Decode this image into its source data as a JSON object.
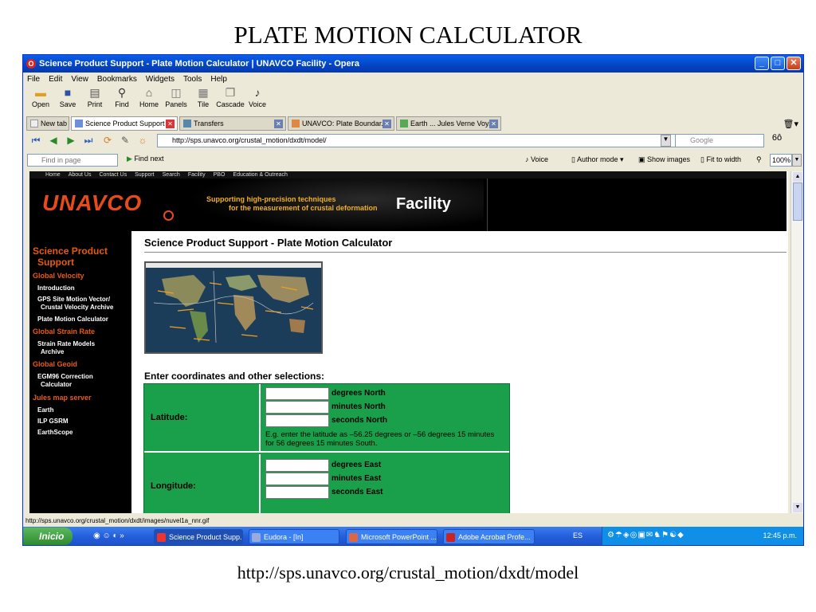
{
  "slide": {
    "title": "PLATE MOTION CALCULATOR",
    "url": "http://sps.unavco.org/crustal_motion/dxdt/model"
  },
  "window": {
    "title": "Science Product Support - Plate Motion Calculator | UNAVCO Facility - Opera",
    "controls": [
      "_",
      "□",
      "✕"
    ]
  },
  "menu": [
    "File",
    "Edit",
    "View",
    "Bookmarks",
    "Widgets",
    "Tools",
    "Help"
  ],
  "toolbar": [
    {
      "label": "Open",
      "icon": "folder-icon"
    },
    {
      "label": "Save",
      "icon": "floppy-icon"
    },
    {
      "label": "Print",
      "icon": "printer-icon"
    },
    {
      "label": "Find",
      "icon": "magnifier-icon"
    },
    {
      "label": "Home",
      "icon": "home-icon"
    },
    {
      "label": "Panels",
      "icon": "panels-icon"
    },
    {
      "label": "Tile",
      "icon": "tile-icon"
    },
    {
      "label": "Cascade",
      "icon": "cascade-icon"
    },
    {
      "label": "Voice",
      "icon": "voice-icon"
    }
  ],
  "tabs": [
    {
      "label": "New tab",
      "active": false
    },
    {
      "label": "Science Product Support ...",
      "active": true
    },
    {
      "label": "Transfers",
      "active": false
    },
    {
      "label": "UNAVCO: Plate Boundar...",
      "active": false
    },
    {
      "label": "Earth ... Jules Verne Voy...",
      "active": false
    }
  ],
  "address": {
    "url": "http://sps.unavco.org/crustal_motion/dxdt/model/",
    "search_placeholder": "Google"
  },
  "findbar": {
    "placeholder": "Find in page",
    "find_next": "Find next",
    "voice": "Voice",
    "author_mode": "Author mode",
    "show_images": "Show images",
    "fit_to_width": "Fit to width",
    "zoom": "100%"
  },
  "site": {
    "nav": [
      "Home",
      "About Us",
      "Contact Us",
      "Support",
      "Search",
      "Facility",
      "PBO",
      "Education & Outreach"
    ],
    "logo": "UNAVCO",
    "tagline_1": "Supporting high-precision techniques",
    "tagline_2": "for the measurement of crustal deformation",
    "facility": "Facility"
  },
  "sidebar": {
    "main_1": "Science Product",
    "main_2": "Support",
    "global_velocity": "Global Velocity",
    "introduction": "Introduction",
    "gps_1": "GPS Site Motion Vector/",
    "gps_2": "Crustal Velocity Archive",
    "plate_motion": "Plate Motion Calculator",
    "global_strain": "Global Strain Rate",
    "strain_1": "Strain Rate Models",
    "strain_2": "Archive",
    "global_geoid": "Global Geoid",
    "egm_1": "EGM96 Correction",
    "egm_2": "Calculator",
    "jules": "Jules map server",
    "earth": "Earth",
    "ilp": "ILP GSRM",
    "earthscope": "EarthScope"
  },
  "content": {
    "title": "Science Product Support - Plate Motion Calculator",
    "enter_label": "Enter coordinates and other selections:",
    "latitude": "Latitude:",
    "longitude": "Longitude:",
    "deg_north": "degrees North",
    "min_north": "minutes North",
    "sec_north": "seconds North",
    "eg_text": "E.g. enter the latitude as –56.25 degrees or –56 degrees 15 minutes for 56 degrees 15 minutes South.",
    "deg_east": "degrees East",
    "min_east": "minutes East",
    "sec_east": "seconds East"
  },
  "status": "http://sps.unavco.org/crustal_motion/dxdt/images/nuvel1a_nnr.gif",
  "taskbar": {
    "start": "Inicio",
    "tasks": [
      {
        "label": "Science Product Supp...",
        "active": true
      },
      {
        "label": "Eudora - [In]",
        "active": false
      },
      {
        "label": "Microsoft PowerPoint ...",
        "active": false
      },
      {
        "label": "Adobe Acrobat Profe...",
        "active": false
      }
    ],
    "lang": "ES",
    "clock": "12:45 p.m."
  },
  "colors": {
    "titlebar": "#0444c4",
    "unavco_orange": "#e84a1a",
    "form_green": "#1aa04a",
    "sidebar_bg": "#000000"
  }
}
